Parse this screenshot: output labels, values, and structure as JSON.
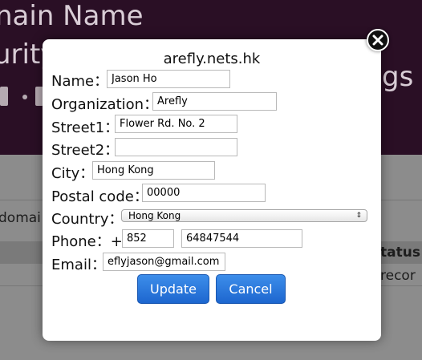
{
  "background": {
    "title_line1": "nain Name",
    "title_line2": "urity",
    "title_line2_tail": "gs t",
    "left_text": "domai",
    "right_header": "tatus",
    "right_cell": "recor"
  },
  "modal": {
    "domain": "arefly.nets.hk",
    "name_label": "Name：",
    "name_value": "Jason Ho",
    "org_label": "Organization：",
    "org_value": "Arefly",
    "street1_label": "Street1：",
    "street1_value": "Flower Rd. No. 2",
    "street2_label": "Street2：",
    "street2_value": "",
    "city_label": "City：",
    "city_value": "Hong Kong",
    "postal_label": "Postal code：",
    "postal_value": "00000",
    "country_label": "Country：",
    "country_value": "Hong Kong",
    "phone_label": "Phone：+",
    "phone_code": "852",
    "phone_number": "64847544",
    "email_label": "Email：",
    "email_value": "eflyjason@gmail.com",
    "update_label": "Update",
    "cancel_label": "Cancel"
  },
  "icons": {
    "close": "close-icon",
    "select_arrows": "chevron-updown-icon"
  },
  "colors": {
    "button_blue": "#2573db",
    "overlay": "#8a8a8a",
    "header_bg": "#2a0f25"
  }
}
